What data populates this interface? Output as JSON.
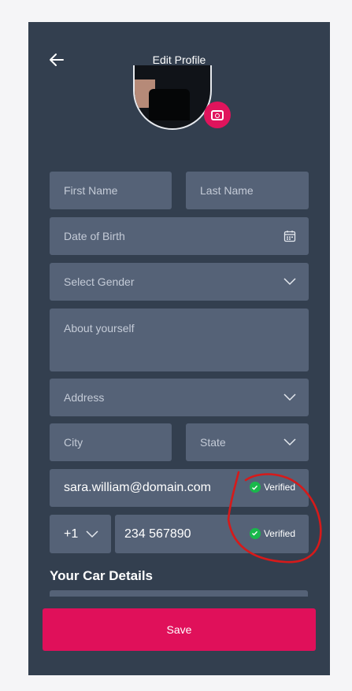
{
  "header": {
    "title": "Edit Profile"
  },
  "form": {
    "first_name_placeholder": "First Name",
    "last_name_placeholder": "Last Name",
    "dob_placeholder": "Date of Birth",
    "gender_placeholder": "Select Gender",
    "about_placeholder": "About yourself",
    "address_placeholder": "Address",
    "city_placeholder": "City",
    "state_placeholder": "State",
    "email_value": "sara.william@domain.com",
    "email_status": "Verified",
    "country_code": "+1",
    "phone_value": "234 567890",
    "phone_status": "Verified"
  },
  "car_section": {
    "title": "Your Car Details"
  },
  "footer": {
    "save_label": "Save"
  },
  "colors": {
    "background": "#333f4f",
    "field": "#556277",
    "accent": "#e0105a",
    "verified": "#19b84b",
    "annotation": "#d61a1a"
  },
  "icons": [
    "back-arrow-icon",
    "camera-icon",
    "calendar-icon",
    "chevron-down-icon",
    "check-circle-icon"
  ]
}
